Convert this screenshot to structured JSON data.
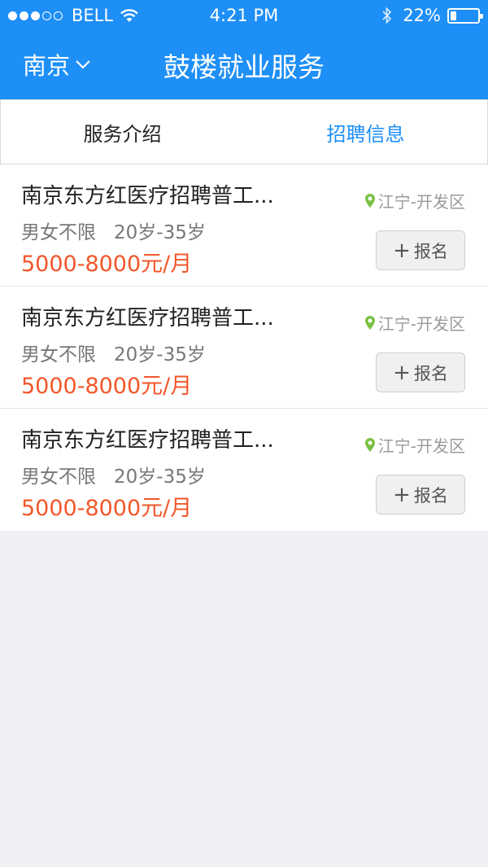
{
  "status_bar": {
    "carrier": "BELL",
    "time": "4:21 PM",
    "battery_percent_text": "22%",
    "battery_level": 0.22
  },
  "header": {
    "city": "南京",
    "title": "鼓楼就业服务",
    "background_color": "#1e8ff6"
  },
  "tabs": [
    {
      "label": "服务介绍",
      "active": false
    },
    {
      "label": "招聘信息",
      "active": true
    }
  ],
  "jobs": [
    {
      "title": "南京东方红医疗招聘普工...",
      "location": "江宁-开发区",
      "gender": "男女不限",
      "age": "20岁-35岁",
      "salary": "5000-8000元/月",
      "signup_label": "报名"
    },
    {
      "title": "南京东方红医疗招聘普工...",
      "location": "江宁-开发区",
      "gender": "男女不限",
      "age": "20岁-35岁",
      "salary": "5000-8000元/月",
      "signup_label": "报名"
    },
    {
      "title": "南京东方红医疗招聘普工...",
      "location": "江宁-开发区",
      "gender": "男女不限",
      "age": "20岁-35岁",
      "salary": "5000-8000元/月",
      "signup_label": "报名"
    }
  ],
  "colors": {
    "accent": "#1e8ff6",
    "salary": "#f2572b",
    "location_pin": "#7ac143"
  },
  "icons": {
    "signal": "signal-dots-icon",
    "wifi": "wifi-icon",
    "bluetooth": "bluetooth-icon",
    "battery": "battery-icon",
    "chevron": "chevron-down-icon",
    "location": "location-pin-icon",
    "plus": "plus-icon"
  }
}
